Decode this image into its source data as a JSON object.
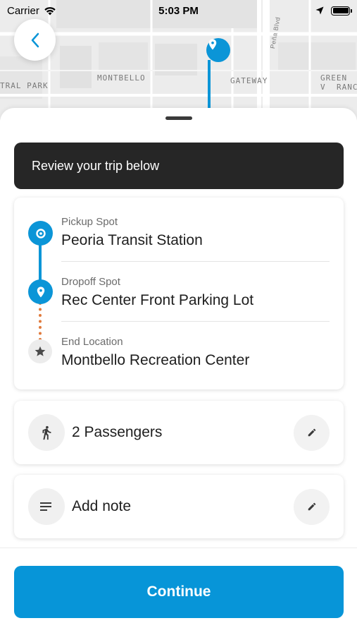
{
  "status_bar": {
    "carrier": "Carrier",
    "time": "5:03 PM",
    "icons": [
      "wifi-icon",
      "location-arrow-icon",
      "battery-icon"
    ]
  },
  "map": {
    "labels": [
      "TRAL PARK",
      "MONTBELLO",
      "GATEWAY",
      "GREEN V",
      "RANC"
    ],
    "road_label": "Peña Blvd",
    "route_color": "#0b95d7"
  },
  "header": {
    "back_icon": "chevron-left-icon"
  },
  "banner": {
    "text": "Review your trip below"
  },
  "trip": {
    "stops": [
      {
        "label": "Pickup Spot",
        "value": "Peoria Transit Station",
        "icon": "pickup-pin-icon"
      },
      {
        "label": "Dropoff Spot",
        "value": "Rec Center Front Parking Lot",
        "icon": "dropoff-pin-icon"
      },
      {
        "label": "End Location",
        "value": "Montbello Recreation Center",
        "icon": "star-icon"
      }
    ]
  },
  "passengers": {
    "text": "2 Passengers",
    "icon": "person-walking-icon",
    "edit_icon": "pencil-icon"
  },
  "note": {
    "text": "Add note",
    "icon": "notes-lines-icon",
    "edit_icon": "pencil-icon"
  },
  "footer": {
    "continue_label": "Continue"
  },
  "colors": {
    "accent": "#0795d8",
    "banner_bg": "#262626",
    "dotted_route": "#e07a3c"
  }
}
